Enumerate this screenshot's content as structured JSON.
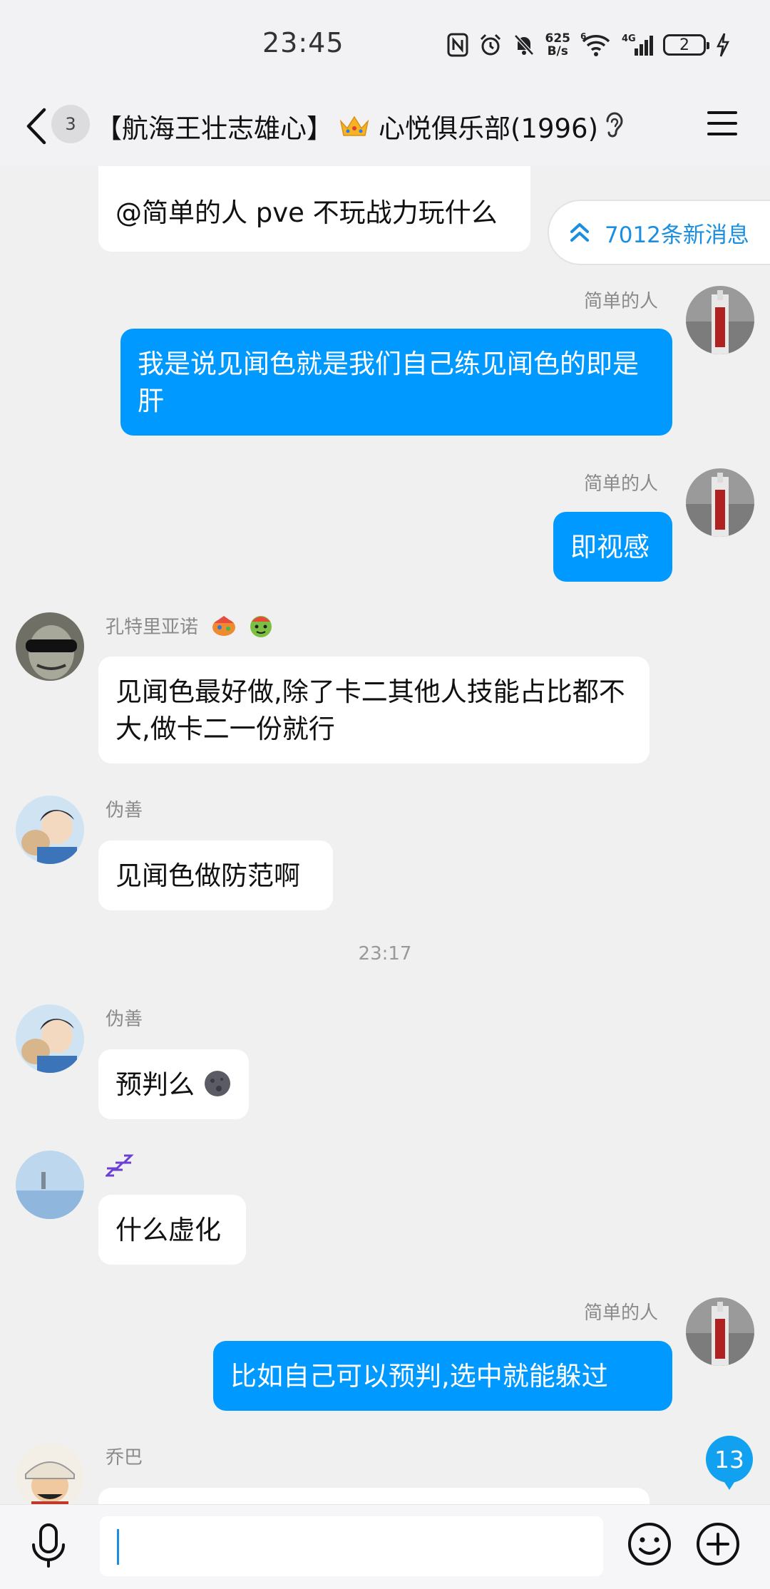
{
  "status_bar": {
    "time": "23:45",
    "net_speed_value": "625",
    "net_speed_unit": "B/s",
    "wifi_label": "6",
    "cellular_label": "4G",
    "battery_level": "2"
  },
  "header": {
    "back_label": "<",
    "unread_count": "3",
    "title_prefix": "【航海王壮志雄心】",
    "title_suffix": "心悦俱乐部(1996)"
  },
  "new_messages_pill": "7012条新消息",
  "messages": [
    {
      "sender": "",
      "text": "@简单的人 pve 不玩战力玩什么"
    },
    {
      "sender": "简单的人",
      "text": "我是说见闻色就是我们自己练见闻色的即是肝"
    },
    {
      "sender": "简单的人",
      "text": "即视感"
    },
    {
      "sender": "孔特里亚诺",
      "text": "见闻色最好做,除了卡二其他人技能占比都不大,做卡二一份就行"
    },
    {
      "sender": "伪善",
      "text": "见闻色做防范啊"
    },
    {
      "sender": "伪善",
      "text": "预判么"
    },
    {
      "sender": "",
      "text": "什么虚化"
    },
    {
      "sender": "简单的人",
      "text": "比如自己可以预判,选中就能躲过"
    },
    {
      "sender": "乔巴",
      "text": ""
    }
  ],
  "time_separator": "23:17",
  "unread_badge": "13",
  "input": {
    "placeholder": ""
  }
}
